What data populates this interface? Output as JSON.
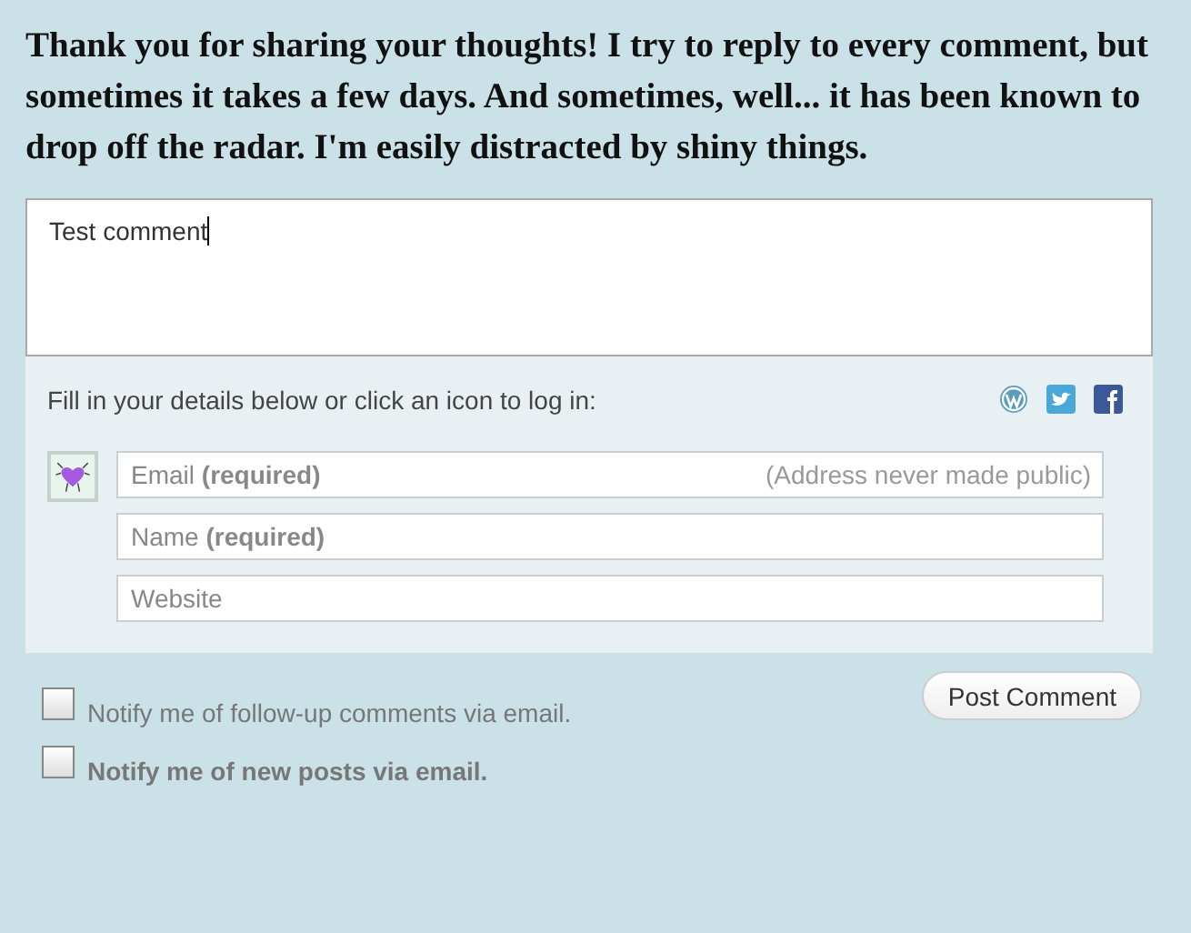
{
  "intro": "Thank you for sharing your thoughts! I try to reply to every comment, but sometimes it takes a few days. And sometimes, well... it has been known to drop off the radar. I'm easily distracted by shiny things.",
  "comment": {
    "value": "Test comment"
  },
  "login_prompt": "Fill in your details below or click an icon to log in:",
  "login_icons": [
    {
      "kind": "wordpress"
    },
    {
      "kind": "twitter"
    },
    {
      "kind": "facebook"
    }
  ],
  "fields": [
    {
      "placeholder": "Email **(required)**",
      "hint": "(Address never made public)"
    },
    {
      "placeholder": "Name **(required)**"
    },
    {
      "placeholder": "Website"
    }
  ],
  "submit": "Post Comment",
  "notify": [
    {
      "label": "Notify me of follow-up comments via email.",
      "kind": "plain",
      "checked": false
    },
    {
      "label": "Notify me of new posts via email.",
      "kind": "strong",
      "checked": false
    }
  ]
}
